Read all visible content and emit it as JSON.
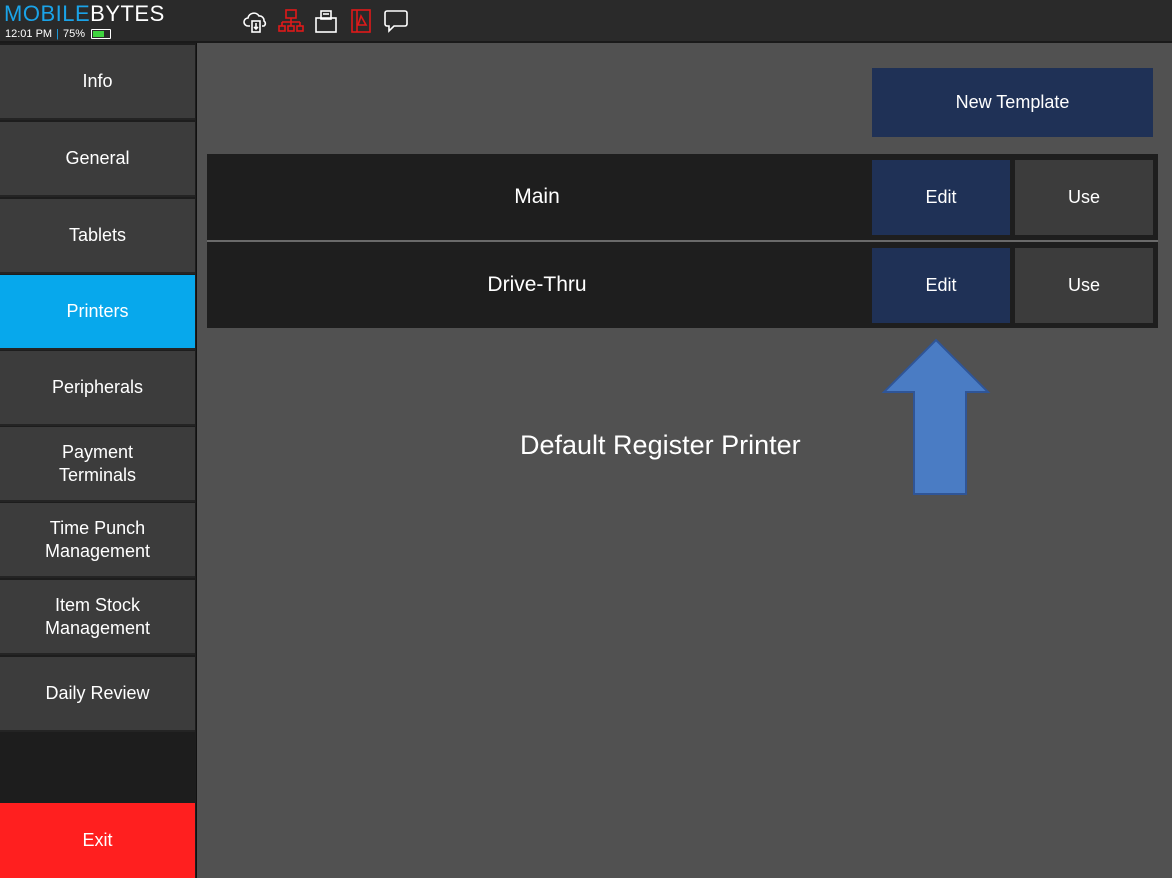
{
  "header": {
    "logo_part1": "MOBILE",
    "logo_part2": "BYTES",
    "time": "12:01 PM",
    "separator": "|",
    "battery": "75%",
    "battery_level": 0.75,
    "icons": [
      "cloud-sync-icon",
      "network-icon",
      "printer-icon",
      "document-alert-icon",
      "chat-icon"
    ],
    "icon_colors": {
      "normal": "#ffffff",
      "alert": "#e01a1a"
    }
  },
  "sidebar": {
    "items": [
      {
        "label": "Info",
        "active": false
      },
      {
        "label": "General",
        "active": false
      },
      {
        "label": "Tablets",
        "active": false
      },
      {
        "label": "Printers",
        "active": true
      },
      {
        "label": "Peripherals",
        "active": false
      },
      {
        "label": "Payment\nTerminals",
        "active": false
      },
      {
        "label": "Time Punch\nManagement",
        "active": false
      },
      {
        "label": "Item Stock\nManagement",
        "active": false
      },
      {
        "label": "Daily Review",
        "active": false
      }
    ],
    "exit_label": "Exit"
  },
  "main": {
    "new_template_label": "New Template",
    "templates": [
      {
        "name": "Main",
        "edit_label": "Edit",
        "use_label": "Use"
      },
      {
        "name": "Drive-Thru",
        "edit_label": "Edit",
        "use_label": "Use"
      }
    ],
    "annotation": "Default Register Printer"
  },
  "colors": {
    "accent": "#07a8ec",
    "button_dark_blue": "#1f3156",
    "exit_red": "#ff1f1f",
    "arrow_blue": "#4a7cc4"
  }
}
